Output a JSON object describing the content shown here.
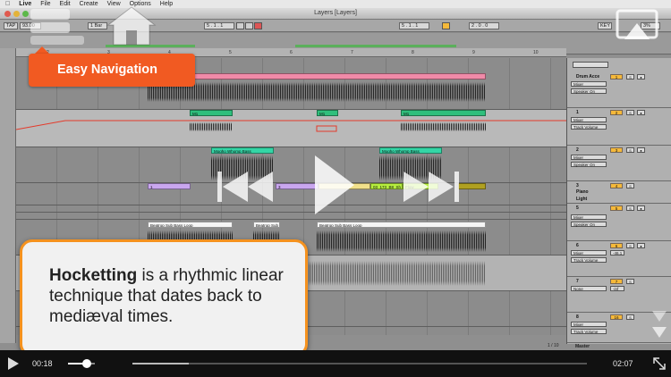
{
  "menubar": {
    "apple": "",
    "items": [
      "Live",
      "File",
      "Edit",
      "Create",
      "View",
      "Options",
      "Help"
    ]
  },
  "window": {
    "title": "Layers  [Layers]"
  },
  "transport": {
    "tap": "TAP",
    "tempo": "93.00",
    "quant": "1 Bar",
    "pos_left": "5 . 1 . 1",
    "pos_right": "5 . 1 . 1",
    "loop_len": "2 . 0 . 0",
    "key": "KEY",
    "midi": "MIDI",
    "cpu": "3%"
  },
  "ruler": [
    "2",
    "3",
    "4",
    "5",
    "6",
    "7",
    "8",
    "9",
    "10"
  ],
  "clips": {
    "midi1": [
      "M1",
      "M1",
      "M1"
    ],
    "mogho": [
      "Mogho Whomp Bass",
      "Mogho Whomp Bass"
    ],
    "tr3": [
      "1",
      "3",
      "03_173_B8_Sh",
      "Flow"
    ],
    "beatrop": [
      "Beatrop Sub Bass Loop",
      "Beatrop Sub",
      "Beatrop Sub Bass Loop"
    ]
  },
  "mixer": {
    "tracks": [
      {
        "name": "Drum Acce",
        "select": "Mixer",
        "select2": "Speaker On",
        "num": "1",
        "vol": ""
      },
      {
        "name": "1",
        "select": "Mixer",
        "select2": "Track Volume",
        "num": "2",
        "vol": ""
      },
      {
        "name": "2",
        "select": "Mixer",
        "select2": "Speaker On",
        "num": "3",
        "vol": ""
      },
      {
        "name": "3",
        "select": "Piano",
        "select2": "Light",
        "num": "4",
        "vol": ""
      },
      {
        "name": "5",
        "select": "Mixer",
        "select2": "Speaker On",
        "num": "5",
        "vol": ""
      },
      {
        "name": "6",
        "select": "Mixer",
        "select2": "Track Volume",
        "num": "6",
        "vol": "-46.1"
      },
      {
        "name": "7",
        "select": "None",
        "select2": "",
        "num": "7",
        "vol": "-inf"
      },
      {
        "name": "8",
        "select": "Mixer",
        "select2": "Track Volume",
        "num": "16",
        "vol": ""
      },
      {
        "name": "Master",
        "select": "",
        "select2": "",
        "num": "",
        "vol": ""
      }
    ],
    "page_count": "1 / 10"
  },
  "overlay": {
    "nav_label": "Easy Navigation",
    "callout_bold": "Hocketting",
    "callout_rest": " is a rhythmic linear technique that dates back to mediæval times."
  },
  "player": {
    "elapsed": "00:18",
    "remaining": "02:07",
    "progress": 0.124,
    "volume": 0.7
  },
  "colors": {
    "accent": "#f15a22",
    "callout_border": "#f5921e",
    "clip_pink": "#f08aa8",
    "clip_green": "#2fbf7c",
    "clip_purple": "#c9a6ef",
    "clip_lime": "#b6ee3e"
  },
  "icons": {
    "home": "home-icon",
    "stack": "stack-icon",
    "fullscreen": "fullscreen-icon",
    "play": "play-icon",
    "rewind": "rewind-icon",
    "forward": "fast-forward-icon",
    "expand": "expand-icon",
    "arrow": "scroll-down-icon"
  }
}
